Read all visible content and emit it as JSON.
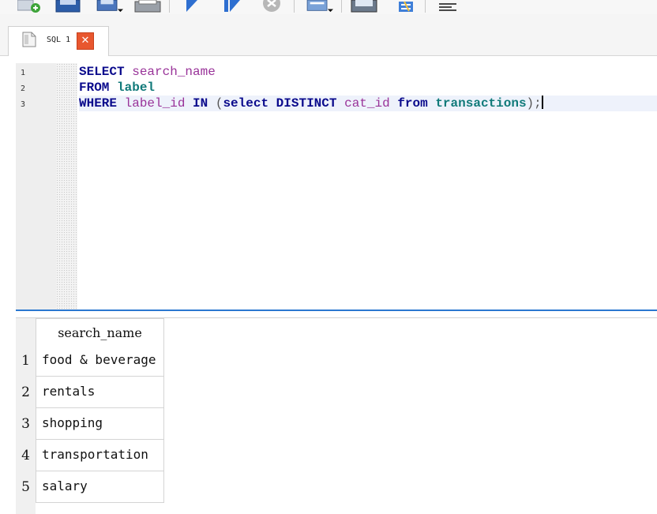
{
  "toolbar": {
    "buttons": [
      "add-connection-icon",
      "save-icon",
      "save-as-icon",
      "print-icon",
      "execute-icon",
      "execute-current-icon",
      "stop-icon",
      "export-icon",
      "import-icon",
      "refresh-icon",
      "format-icon"
    ]
  },
  "tab": {
    "label": "SQL 1",
    "close_glyph": "✕"
  },
  "editor": {
    "line_numbers": [
      "1",
      "2",
      "3"
    ],
    "lines": [
      [
        {
          "t": "SELECT",
          "c": "kw"
        },
        {
          "t": " ",
          "c": "op"
        },
        {
          "t": "search_name",
          "c": "col"
        }
      ],
      [
        {
          "t": "FROM",
          "c": "kw"
        },
        {
          "t": " ",
          "c": "op"
        },
        {
          "t": "label",
          "c": "tbl"
        }
      ],
      [
        {
          "t": "WHERE",
          "c": "kw"
        },
        {
          "t": " ",
          "c": "op"
        },
        {
          "t": "label_id",
          "c": "col"
        },
        {
          "t": " ",
          "c": "op"
        },
        {
          "t": "IN",
          "c": "kw"
        },
        {
          "t": " (",
          "c": "op"
        },
        {
          "t": "select",
          "c": "kw"
        },
        {
          "t": " ",
          "c": "op"
        },
        {
          "t": "DISTINCT",
          "c": "kw"
        },
        {
          "t": " ",
          "c": "op"
        },
        {
          "t": "cat_id",
          "c": "col"
        },
        {
          "t": " ",
          "c": "op"
        },
        {
          "t": "from",
          "c": "kw"
        },
        {
          "t": " ",
          "c": "op"
        },
        {
          "t": "transactions",
          "c": "tbl"
        },
        {
          "t": ");",
          "c": "op"
        }
      ]
    ]
  },
  "results": {
    "columns": [
      "search_name"
    ],
    "row_numbers": [
      "1",
      "2",
      "3",
      "4",
      "5"
    ],
    "rows": [
      "food & beverage",
      "rentals",
      "shopping",
      "transportation",
      "salary"
    ]
  },
  "colors": {
    "keyword": "#0a0a8c",
    "identifier": "#993399",
    "table": "#117a7a",
    "splitter": "#2b78d0",
    "close": "#e8572f"
  }
}
